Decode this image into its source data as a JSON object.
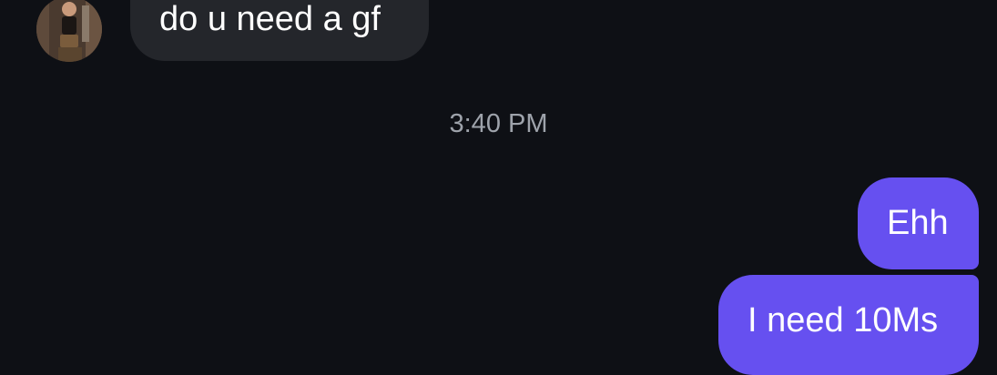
{
  "conversation": {
    "messages": [
      {
        "direction": "incoming",
        "text": "do u need a gf"
      },
      {
        "direction": "outgoing",
        "text": "Ehh"
      },
      {
        "direction": "outgoing",
        "text": "I need 10Ms"
      }
    ],
    "timestamp": "3:40 PM"
  },
  "colors": {
    "background": "#0e1015",
    "incoming_bubble": "#24262b",
    "outgoing_bubble": "#6650f0",
    "timestamp_text": "#9ea3ab"
  }
}
